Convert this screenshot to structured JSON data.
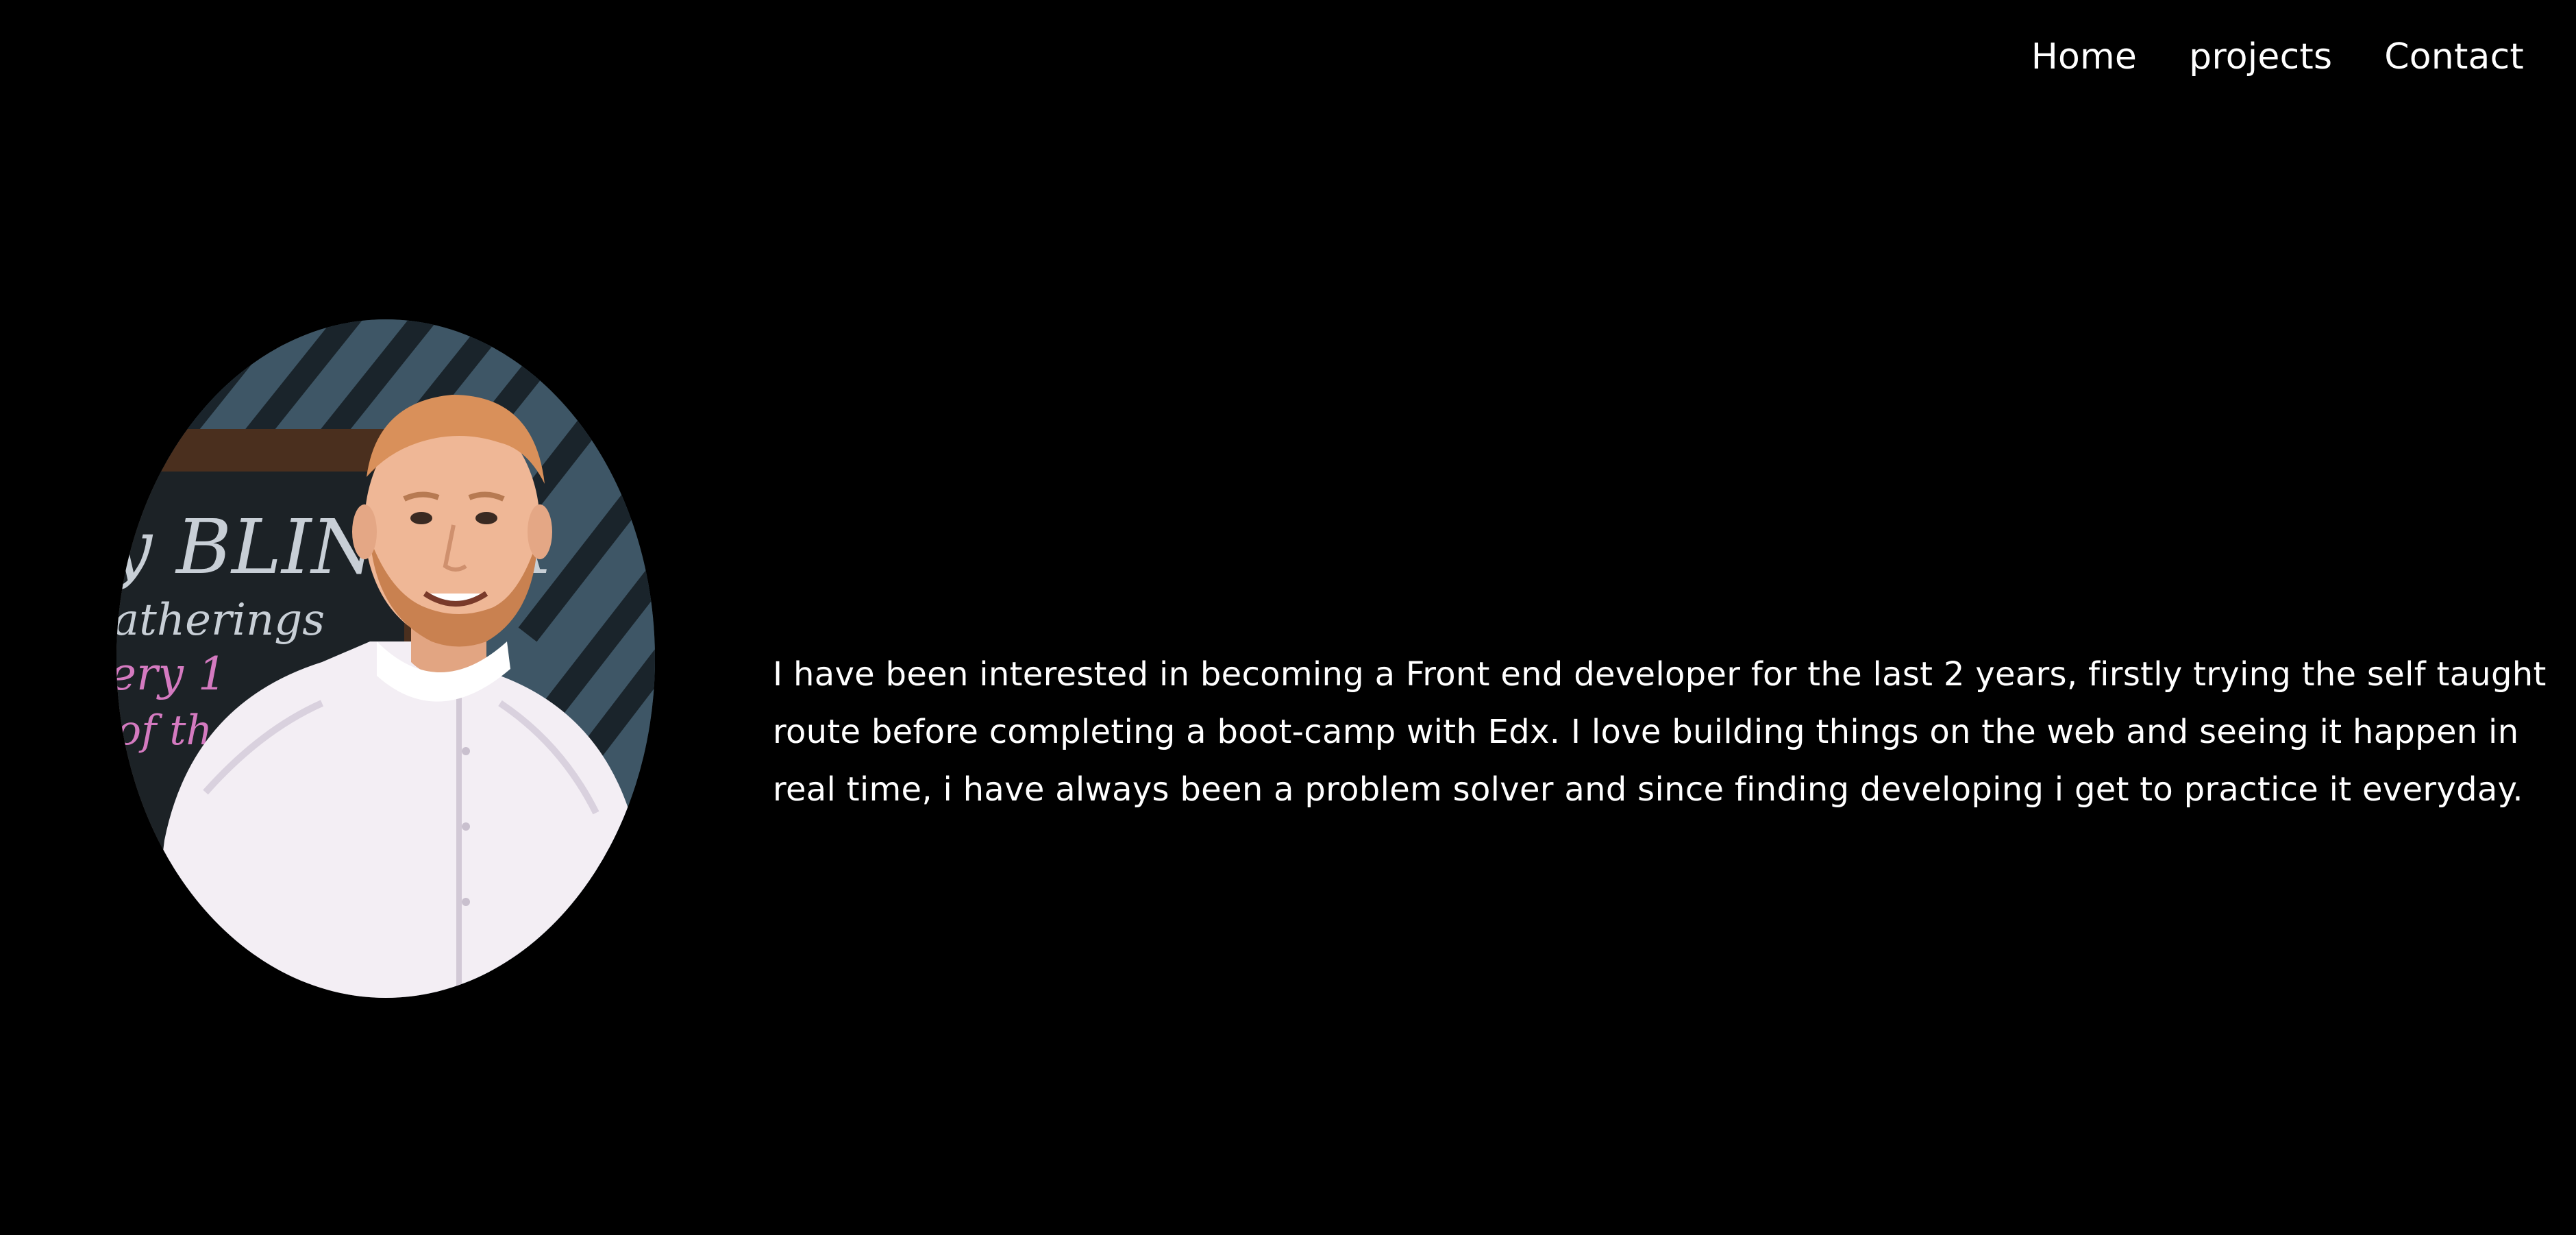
{
  "nav": {
    "items": [
      {
        "label": "Home"
      },
      {
        "label": "projects"
      },
      {
        "label": "Contact"
      }
    ]
  },
  "profile": {
    "image_alt": "portrait photo",
    "sign_text": "y BLINDER",
    "sign_text_2": "atherings",
    "sign_text_3": "ery 1",
    "sign_text_4": "of th"
  },
  "about": {
    "text": "I have been interested in becoming a Front end developer for the last 2 years, firstly trying the self taught route before completing a boot-camp with Edx. I love building things on the web and seeing it happen in real time, i have always been a problem solver and since finding developing i get to practice it everyday."
  },
  "colors": {
    "background": "#000000",
    "text": "#ffffff"
  }
}
